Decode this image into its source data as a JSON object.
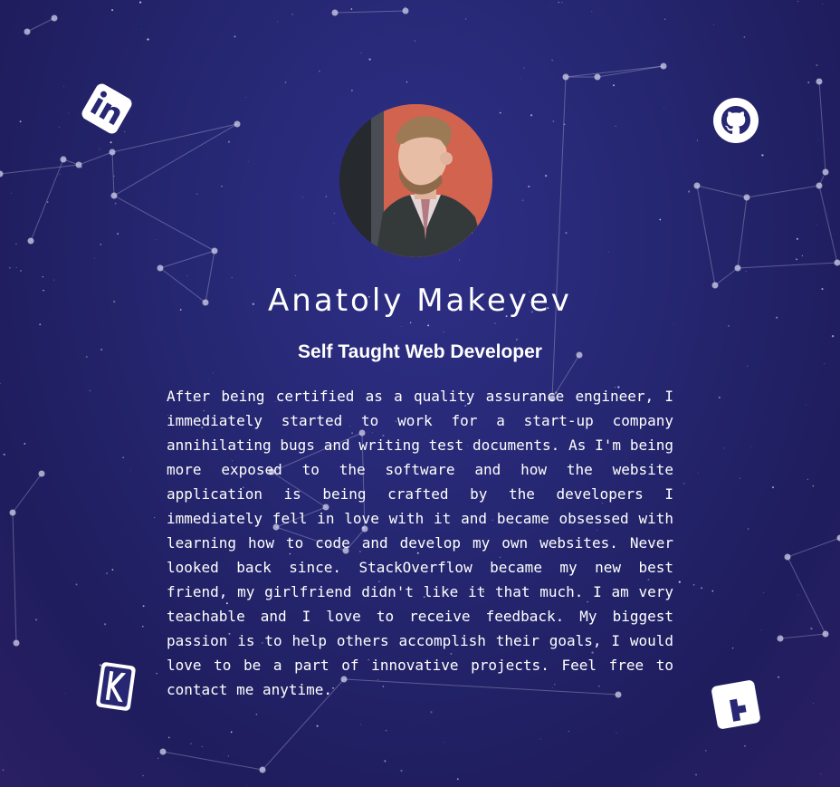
{
  "profile": {
    "name": "Anatoly Makeyev",
    "role": "Self Taught Web Developer",
    "bio": "After being certified as a quality assurance engineer, I immediately started to work for a start-up company annihilating bugs and writing test documents. As I'm being more exposed to the software and how the website application is being crafted by the developers I immediately fell in love with it and became obsessed with learning how to code and develop my own websites. Never looked back since. StackOverflow became my new best friend, my girlfriend didn't like it that much. I am very teachable and I love to receive feedback. My biggest passion is to help others accomplish their goals, I would love to be a part of innovative projects. Feel free to contact me anytime."
  },
  "social_links": [
    {
      "icon": "linkedin-icon"
    },
    {
      "icon": "github-icon"
    },
    {
      "icon": "kaggle-icon"
    },
    {
      "icon": "hashnode-icon"
    }
  ],
  "colors": {
    "background": "#262772",
    "text": "#ffffff"
  }
}
